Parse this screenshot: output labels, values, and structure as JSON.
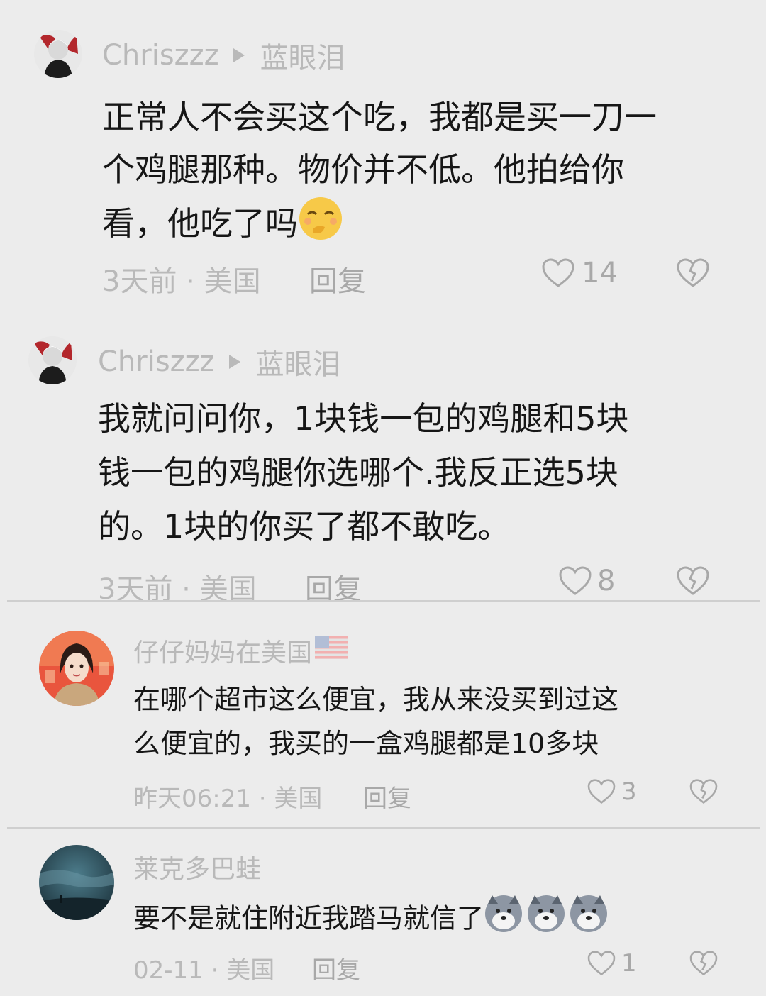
{
  "comments": [
    {
      "username": "Chriszzz",
      "reply_to": "蓝眼泪",
      "lines": [
        "正常人不会买这个吃，我都是买一刀一",
        "个鸡腿那种。物价并不低。他拍给你",
        "看，他吃了吗"
      ],
      "emoji": "smirk-emoji",
      "time": "3天前",
      "location": "美国",
      "reply_label": "回复",
      "likes": "14"
    },
    {
      "username": "Chriszzz",
      "reply_to": "蓝眼泪",
      "lines": [
        "我就问问你，1块钱一包的鸡腿和5块",
        "钱一包的鸡腿你选哪个.我反正选5块",
        "的。1块的你买了都不敢吃。"
      ],
      "time": "3天前",
      "location": "美国",
      "reply_label": "回复",
      "likes": "8"
    },
    {
      "username": "仔仔妈妈在美国",
      "flag": "us-flag-icon",
      "lines": [
        "在哪个超市这么便宜，我从来没买到过这",
        "么便宜的，我买的一盒鸡腿都是10多块"
      ],
      "time": "昨天06:21",
      "location": "美国",
      "reply_label": "回复",
      "likes": "3"
    },
    {
      "username": "莱克多巴蛙",
      "lines": [
        "要不是就住附近我踏马就信了"
      ],
      "emoji": "doge-emoji",
      "time": "02-11",
      "location": "美国",
      "reply_label": "回复",
      "likes": "1"
    }
  ],
  "separator": " · ",
  "colors": {
    "background": "#ececec",
    "text": "#161616",
    "muted": "#b9b9b9",
    "divider": "#cfcfcf"
  }
}
